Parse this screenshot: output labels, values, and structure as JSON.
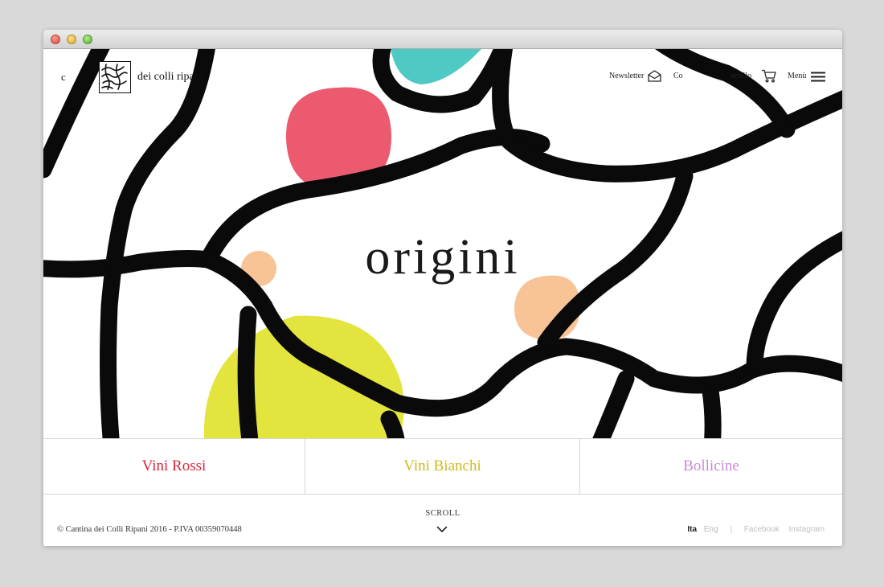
{
  "header": {
    "logo_text": "dei colli ripani",
    "logo_prefix": "c",
    "nav": {
      "newsletter": "Newsletter",
      "contatti": "Co",
      "carrello": "arrello",
      "menu": "Menù"
    },
    "icons": {
      "newsletter": "envelope-icon",
      "cart": "cart-icon",
      "menu": "hamburger-icon"
    }
  },
  "hero": {
    "title": "origini",
    "colors": {
      "lines": "#0a0a0a",
      "teal": "#4ec9c4",
      "red": "#eb5a6e",
      "peach": "#f8c396",
      "yellow": "#e4e43e"
    }
  },
  "categories": [
    {
      "label": "Vini Rossi",
      "color": "#d3283c"
    },
    {
      "label": "Vini Bianchi",
      "color": "#c9bd1e"
    },
    {
      "label": "Bollicine",
      "color": "#c98ad6"
    }
  ],
  "footer": {
    "copyright": "© Cantina dei Colli Ripani 2016 - P.IVA 00359070448",
    "scroll": "SCROLL",
    "lang_active": "Ita",
    "lang_other": "Eng",
    "separator": "|",
    "social": [
      "Facebook",
      "Instagram"
    ]
  }
}
